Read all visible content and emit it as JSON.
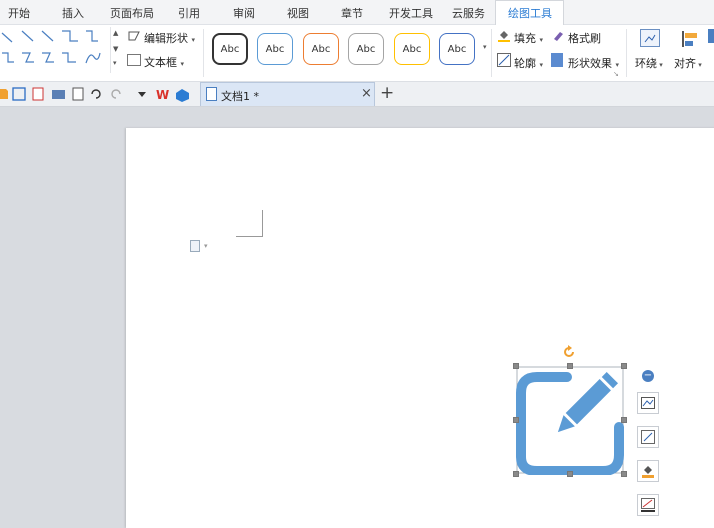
{
  "menu": {
    "items": [
      {
        "label": "开始"
      },
      {
        "label": "插入"
      },
      {
        "label": "页面布局"
      },
      {
        "label": "引用"
      },
      {
        "label": "审阅"
      },
      {
        "label": "视图"
      },
      {
        "label": "章节"
      },
      {
        "label": "开发工具"
      },
      {
        "label": "云服务"
      },
      {
        "label": "绘图工具"
      }
    ],
    "active": "绘图工具"
  },
  "ribbon": {
    "edit_shape": "编辑形状",
    "text_box": "文本框",
    "style_buttons": [
      "Abc",
      "Abc",
      "Abc",
      "Abc",
      "Abc",
      "Abc"
    ],
    "style_colors": [
      "#333333",
      "#5b9bd5",
      "#ed7d31",
      "#a5a5a5",
      "#ffc000",
      "#4472c4"
    ],
    "fill": "填充",
    "format_brush": "格式刷",
    "outline": "轮廓",
    "shape_effect": "形状效果",
    "wrap": "环绕",
    "align": "对齐"
  },
  "tabs": {
    "document_title": "文档1 *",
    "close_icon": "close-icon",
    "new_tab_icon": "plus-icon"
  },
  "colors": {
    "accent": "#2b7cd3",
    "shape_blue": "#5b9bd5"
  }
}
